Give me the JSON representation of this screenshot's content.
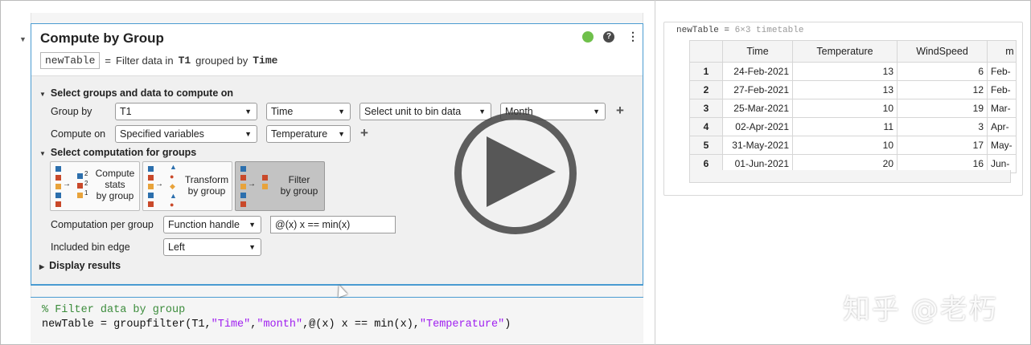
{
  "task": {
    "title": "Compute by Group",
    "output_var": "newTable",
    "equals": "=",
    "summary_pre": "Filter data in",
    "summary_table": "T1",
    "summary_mid": "grouped by",
    "summary_var": "Time",
    "status": "green"
  },
  "sections": {
    "groups_data": "Select groups and data to compute on",
    "computation": "Select computation for groups",
    "display": "Display results"
  },
  "group_by": {
    "label": "Group by",
    "table": "T1",
    "variable": "Time",
    "bin_unit": "Select unit to bin data",
    "bin": "Month"
  },
  "compute_on": {
    "label": "Compute on",
    "mode": "Specified variables",
    "variable": "Temperature"
  },
  "tiles": [
    {
      "label_lines": [
        "Compute",
        "stats",
        "by group"
      ],
      "selected": false
    },
    {
      "label_lines": [
        "Transform",
        "by group"
      ],
      "selected": false
    },
    {
      "label_lines": [
        "Filter",
        "by group"
      ],
      "selected": true
    }
  ],
  "tile_digits": [
    "2",
    "2",
    "1"
  ],
  "computation_per_group": {
    "label": "Computation per group",
    "type": "Function handle",
    "expression": "@(x) x == min(x)"
  },
  "bin_edge": {
    "label": "Included bin edge",
    "value": "Left"
  },
  "code": {
    "comment": "% Filter data by group",
    "line_pre": "newTable = groupfilter(T1,",
    "s1": "\"Time\"",
    "comma1": ",",
    "s2": "\"month\"",
    "mid": ",@(x) x == min(x),",
    "s3": "\"Temperature\"",
    "end": ")"
  },
  "output": {
    "var": "newTable",
    "eq": "=",
    "dims": "6×3 timetable",
    "columns": [
      "Time",
      "Temperature",
      "WindSpeed",
      "m"
    ],
    "rows": [
      {
        "i": "1",
        "time": "24-Feb-2021",
        "temp": "13",
        "wind": "6",
        "m": "Feb-"
      },
      {
        "i": "2",
        "time": "27-Feb-2021",
        "temp": "13",
        "wind": "12",
        "m": "Feb-"
      },
      {
        "i": "3",
        "time": "25-Mar-2021",
        "temp": "10",
        "wind": "19",
        "m": "Mar-"
      },
      {
        "i": "4",
        "time": "02-Apr-2021",
        "temp": "11",
        "wind": "3",
        "m": "Apr-"
      },
      {
        "i": "5",
        "time": "31-May-2021",
        "temp": "10",
        "wind": "17",
        "m": "May-"
      },
      {
        "i": "6",
        "time": "01-Jun-2021",
        "temp": "20",
        "wind": "16",
        "m": "Jun-"
      }
    ]
  },
  "watermark": "知乎 @老朽",
  "colors": {
    "accent": "#4a9bd1",
    "status_green": "#6fc04b",
    "tile_blue": "#2c6fad",
    "tile_orange": "#e8a33b",
    "tile_red": "#c9492a",
    "code_comment": "#3c8c3c",
    "code_string": "#a020f0"
  }
}
